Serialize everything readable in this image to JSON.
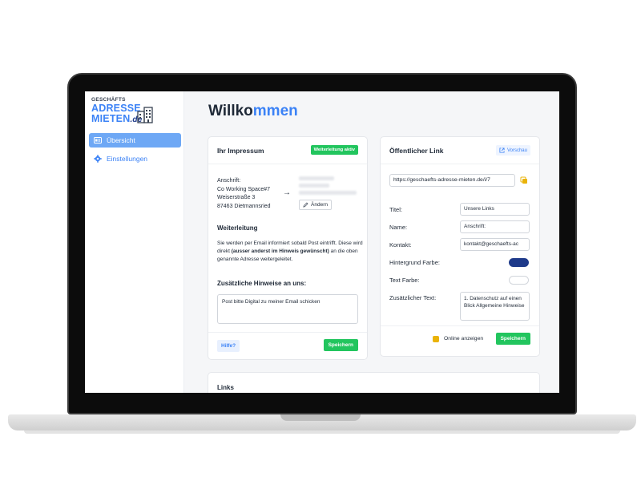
{
  "colors": {
    "accent": "#3b82f6",
    "success": "#22c55e",
    "background_color_swatch": "#1e3a8a",
    "text_color_swatch": "#ffffff",
    "checkbox": "#eab308"
  },
  "logo": {
    "small": "GESCHÄFTS",
    "line1": "ADRESSE",
    "line2": "MIETEN",
    "suffix": ".de",
    "icon": "building-icon"
  },
  "sidebar": {
    "items": [
      {
        "label": "Übersicht",
        "icon": "dashboard-icon",
        "active": true
      },
      {
        "label": "Einstellungen",
        "icon": "gear-icon",
        "active": false
      }
    ]
  },
  "page": {
    "title_prefix": "Willko",
    "title_accent": "mmen"
  },
  "impressum": {
    "title": "Ihr Impressum",
    "status_badge": "Weiterleitung aktiv",
    "address_label": "Anschrift:",
    "address_lines": [
      "Co Working Space#7",
      "Weiserstraße 3",
      "87463 Dietmannsried"
    ],
    "change_button": "Ändern",
    "forwarding_heading": "Weiterleitung",
    "forwarding_text_1": "Sie werden per Email informiert sobald Post eintrifft. Diese wird direkt ",
    "forwarding_text_bold": "(ausser anderst im Hinweis gewünscht)",
    "forwarding_text_2": " an die oben genannte Adresse weitergeleitet.",
    "notes_heading": "Zusätzliche Hinweise an uns:",
    "notes_value": "Post bitte Digital zu meiner Email schicken",
    "help_button": "Hilfe?",
    "save_button": "Speichern"
  },
  "public_link": {
    "title": "Öffentlicher Link",
    "preview_button": "Vorschau",
    "url": "https://geschaefts-adresse-mieten.de/i/7",
    "fields": {
      "titel_label": "Titel:",
      "titel_value": "Unsere Links",
      "name_label": "Name:",
      "name_value": "Anschrift:",
      "kontakt_label": "Kontakt:",
      "kontakt_value": "kontakt@geschaefts-ac",
      "bg_color_label": "Hintergrund Farbe:",
      "text_color_label": "Text Farbe:",
      "extra_text_label": "Zusätzlicher Text:",
      "extra_text_value": "1. Datenschutz auf einen Blick Allgemeine Hinweise"
    },
    "online_label": "Online anzeigen",
    "save_button": "Speichern"
  },
  "links_section": {
    "title": "Links"
  }
}
